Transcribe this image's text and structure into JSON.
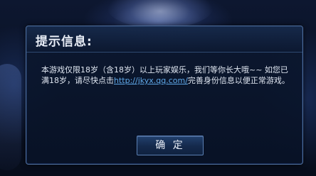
{
  "dialog": {
    "title": "提示信息:",
    "message_before_link": "本游戏仅限18岁（含18岁）以上玩家娱乐，我们等你长大哦~~ 如您已满18岁，请尽快点击",
    "link_text": "http://jkyx.qq.com/",
    "message_after_link": "完善身份信息以便正常游戏。",
    "ok_label": "确 定"
  },
  "colors": {
    "link": "#5fa8e8",
    "border": "#4f6f9c",
    "text": "#dfe6f1"
  }
}
